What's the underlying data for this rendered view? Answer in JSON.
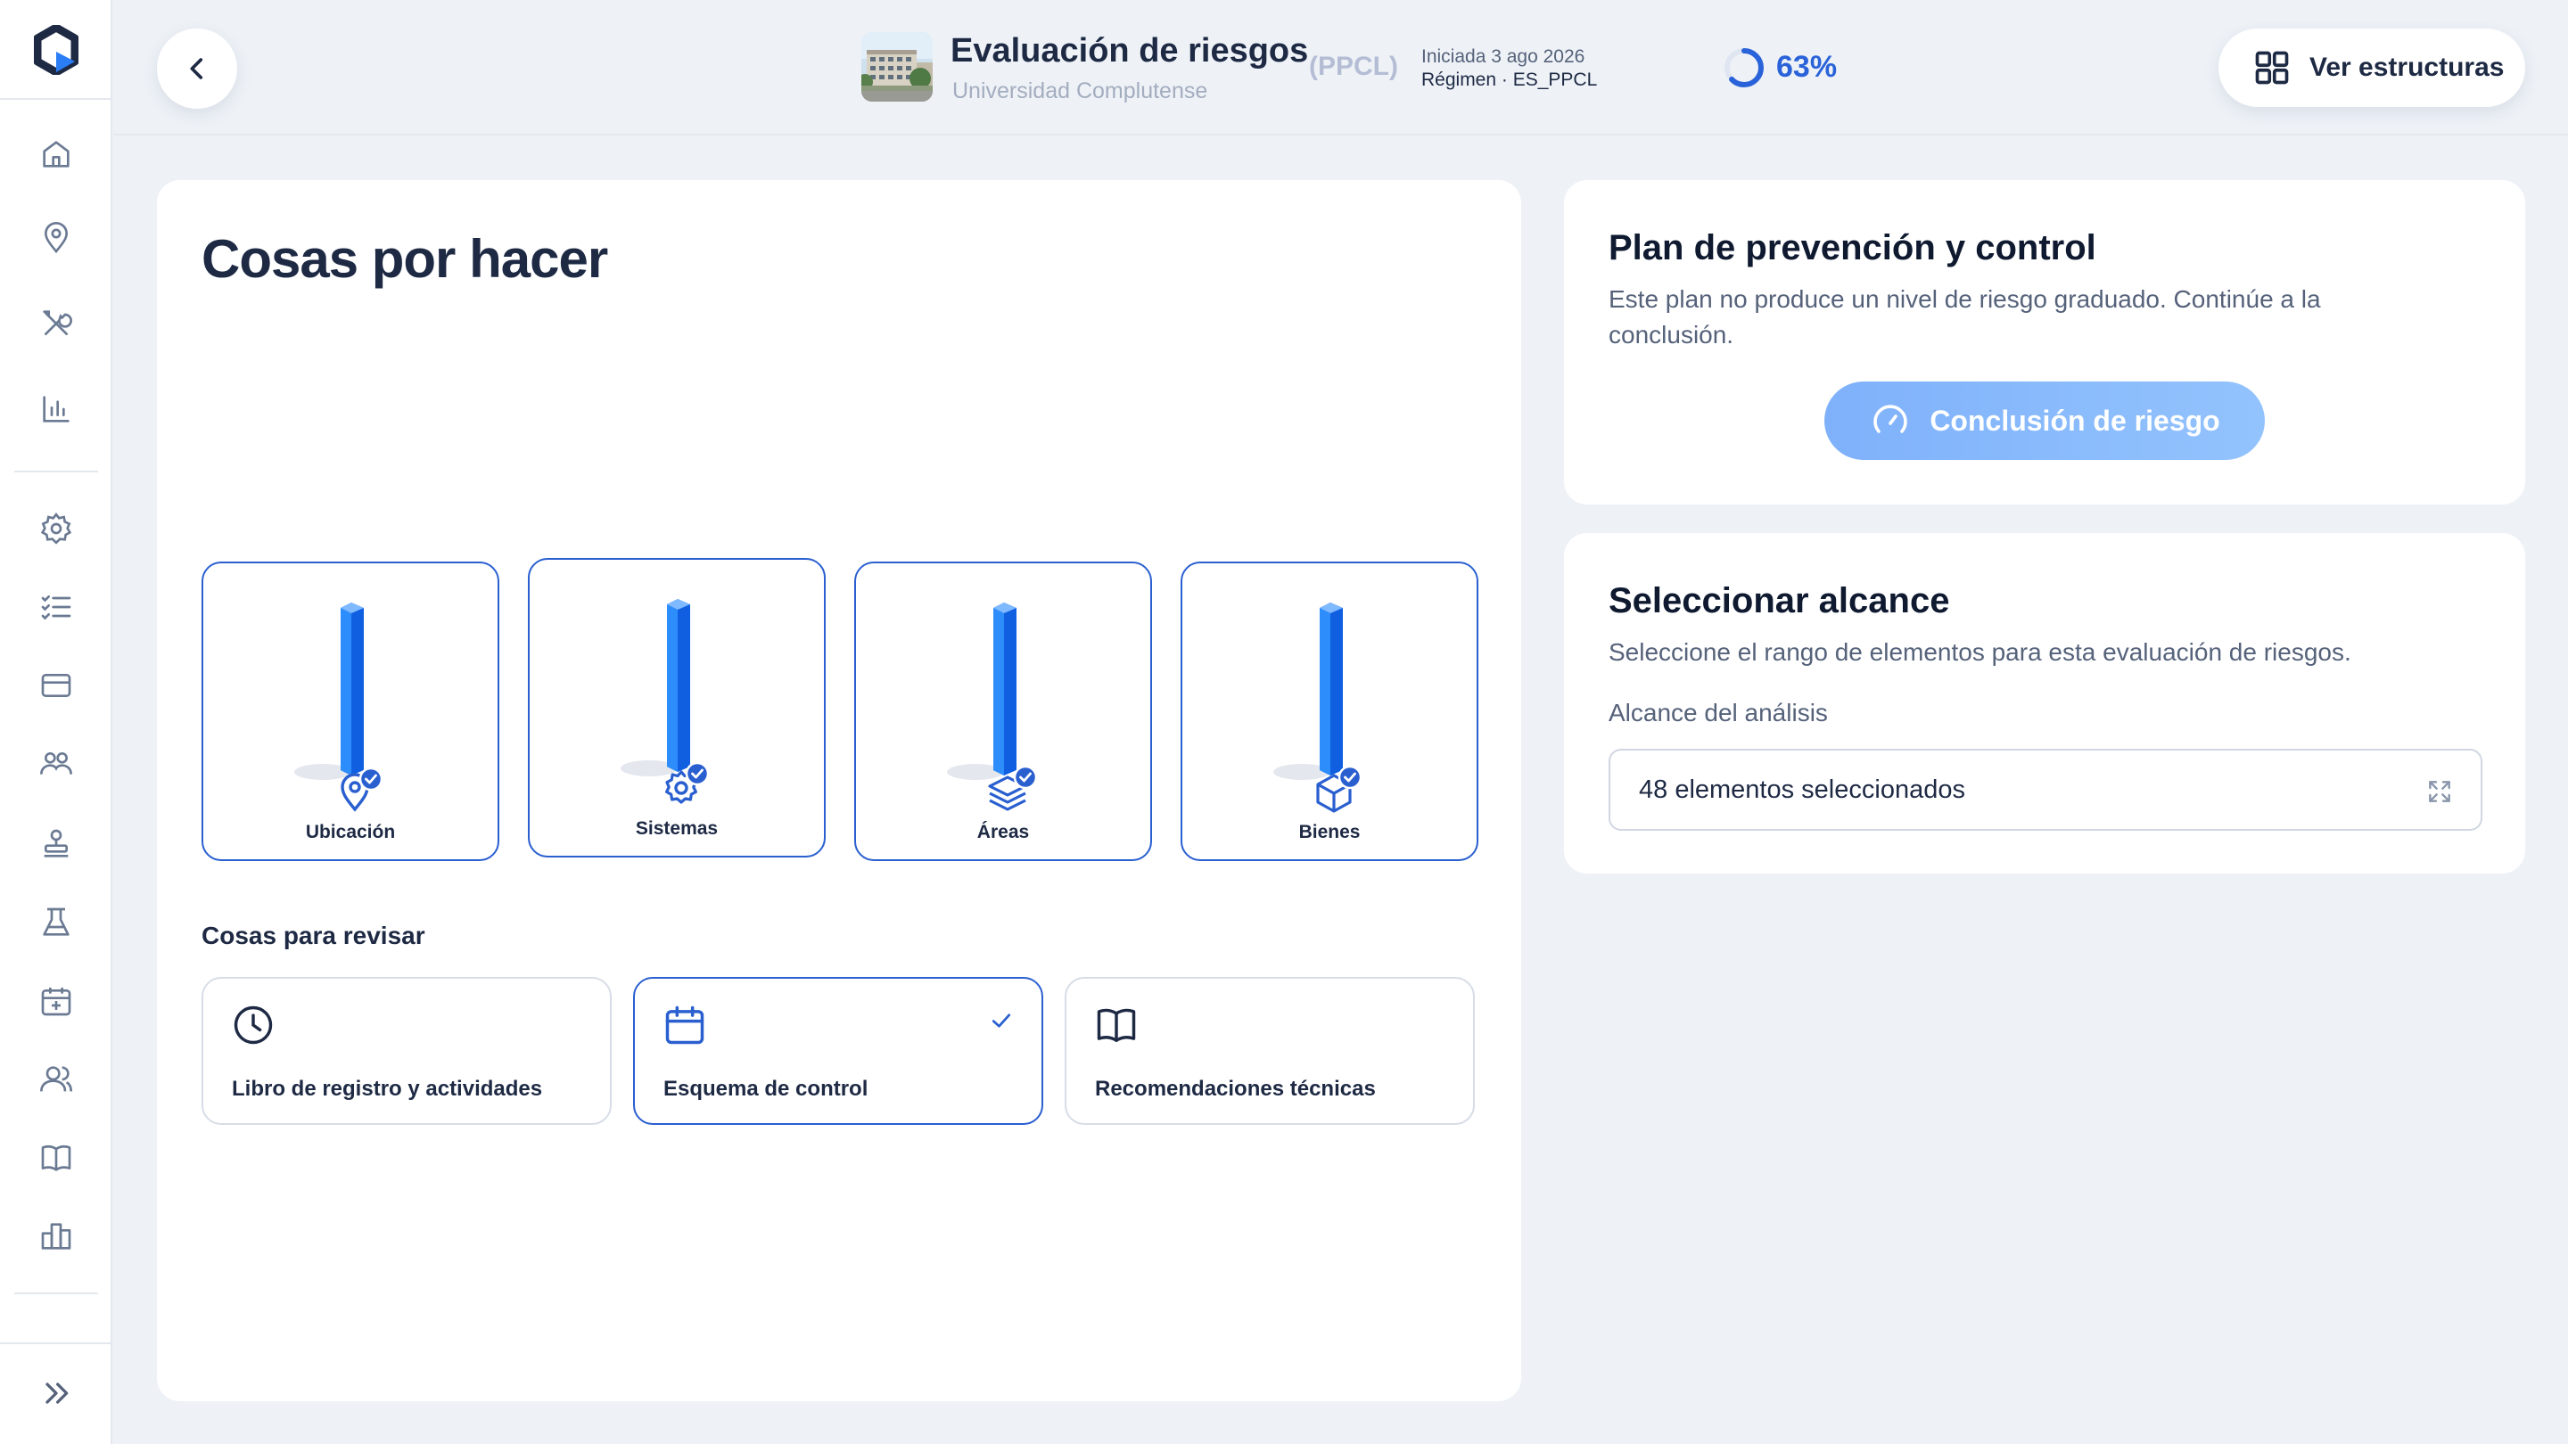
{
  "header": {
    "title": "Evaluación de riesgos",
    "subtitle": "Universidad Complutense",
    "code": "(PPCL)",
    "started": "Iniciada 3 ago 2026",
    "regime": "Régimen · ES_PPCL",
    "progress_label": "63%",
    "progress_value": 0.63,
    "structures_button": "Ver estructuras"
  },
  "sidebar": {
    "items": [
      {
        "icon": "home-icon"
      },
      {
        "icon": "location-pin-icon"
      },
      {
        "icon": "tools-icon"
      },
      {
        "icon": "bar-chart-icon"
      },
      {
        "icon": "gear-icon"
      },
      {
        "icon": "checklist-icon"
      },
      {
        "icon": "credit-card-icon"
      },
      {
        "icon": "group-icon"
      },
      {
        "icon": "stamp-icon"
      },
      {
        "icon": "flask-icon"
      },
      {
        "icon": "calendar-plus-icon"
      },
      {
        "icon": "users-icon"
      },
      {
        "icon": "book-icon"
      },
      {
        "icon": "building-chart-icon"
      }
    ],
    "expand_icon": "double-chevron-right-icon"
  },
  "main": {
    "title": "Cosas por hacer",
    "tiles": [
      {
        "label": "Ubicación",
        "icon": "location-pin-icon",
        "completed": true
      },
      {
        "label": "Sistemas",
        "icon": "gear-icon",
        "completed": true
      },
      {
        "label": "Áreas",
        "icon": "layers-icon",
        "completed": true
      },
      {
        "label": "Bienes",
        "icon": "cube-icon",
        "completed": true
      }
    ],
    "review_label": "Cosas para revisar",
    "review_cards": [
      {
        "label": "Libro de registro y actividades",
        "icon": "clock-icon",
        "active": false
      },
      {
        "label": "Esquema de control",
        "icon": "calendar-icon",
        "active": true
      },
      {
        "label": "Recomendaciones técnicas",
        "icon": "book-icon",
        "active": false
      }
    ]
  },
  "plan": {
    "title": "Plan de prevención y control",
    "text": "Este plan no produce un nivel de riesgo graduado. Continúe a la conclusión.",
    "button": "Conclusión de riesgo",
    "button_icon": "gauge-icon"
  },
  "scope": {
    "title": "Seleccionar alcance",
    "text": "Seleccione el rango de elementos para esta evaluación de riesgos.",
    "field_label": "Alcance del análisis",
    "field_value": "48 elementos seleccionados",
    "field_icon": "expand-icon"
  },
  "colors": {
    "accent": "#2a5fd0",
    "bar_blue": "#1e7bf5",
    "button_light": "#8bbcfc",
    "background": "#eef2f7"
  }
}
